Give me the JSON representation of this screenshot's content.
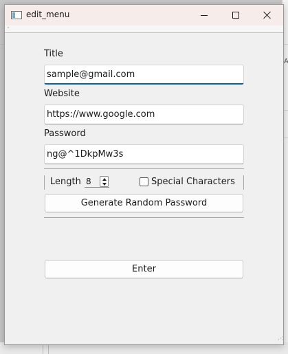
{
  "window": {
    "title": "edit_menu",
    "menubar_marker": "'"
  },
  "form": {
    "title_label": "Title",
    "title_value": "sample@gmail.com",
    "website_label": "Website",
    "website_value": "https://www.google.com",
    "password_label": "Password",
    "password_value": "ng@^1DkpMw3s",
    "length_label": "Length",
    "length_value": "8",
    "special_chars_label": "Special Characters",
    "special_chars_checked": false,
    "generate_button": "Generate Random Password",
    "enter_button": "Enter"
  },
  "background": {
    "right_mark": "A"
  },
  "colors": {
    "titlebar": "#f6ecea",
    "window_bg": "#f0f0f0",
    "focus_accent": "#005fb8"
  }
}
